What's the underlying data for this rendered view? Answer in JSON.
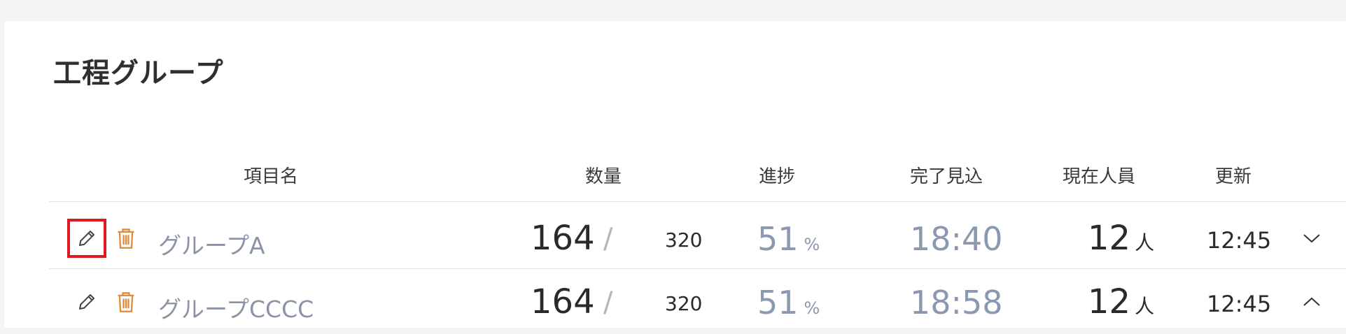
{
  "title": "工程グループ",
  "headers": {
    "name": "項目名",
    "quantity": "数量",
    "progress": "進捗",
    "eta": "完了見込",
    "people": "現在人員",
    "updated": "更新"
  },
  "rows": [
    {
      "name": "グループA",
      "quantity": "164",
      "slash": "/",
      "total": "320",
      "progress": "51",
      "progress_unit": "%",
      "eta": "18:40",
      "people": "12",
      "people_unit": "人",
      "updated": "12:45",
      "expand_icon": "chevron-down-icon"
    },
    {
      "name": "グループCCCC",
      "quantity": "164",
      "slash": "/",
      "total": "320",
      "progress": "51",
      "progress_unit": "%",
      "eta": "18:58",
      "people": "12",
      "people_unit": "人",
      "updated": "12:45",
      "expand_icon": "chevron-up-icon"
    }
  ],
  "colors": {
    "link": "#8a93a8",
    "trash": "#e08a3c",
    "selection": "#e0191e"
  }
}
